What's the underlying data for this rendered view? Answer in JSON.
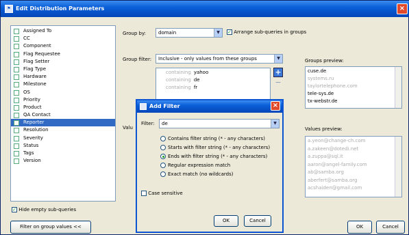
{
  "window": {
    "title": "Edit Distribution Parameters",
    "close": "×"
  },
  "fields": [
    {
      "label": "Assigned To"
    },
    {
      "label": "CC"
    },
    {
      "label": "Component"
    },
    {
      "label": "Flag Requestee"
    },
    {
      "label": "Flag Setter"
    },
    {
      "label": "Flag Type"
    },
    {
      "label": "Hardware"
    },
    {
      "label": "Milestone"
    },
    {
      "label": "OS"
    },
    {
      "label": "Priority"
    },
    {
      "label": "Product"
    },
    {
      "label": "QA Contact"
    },
    {
      "label": "Reporter"
    },
    {
      "label": "Resolution"
    },
    {
      "label": "Severity"
    },
    {
      "label": "Status"
    },
    {
      "label": "Tags"
    },
    {
      "label": "Version"
    }
  ],
  "selected_field": "Reporter",
  "hide_empty": {
    "label": "Hide empty sub-queries",
    "checked": true
  },
  "filter_button": "Filter on group values <<",
  "group_by": {
    "label": "Group by:",
    "value": "domain",
    "arrange_label": "Arrange sub-queries in groups",
    "arrange_checked": true
  },
  "group_filter": {
    "label": "Group filter:",
    "value": "Inclusive - only values from these groups"
  },
  "filters": [
    {
      "op": "containing",
      "val": "yahoo"
    },
    {
      "op": "containing",
      "val": "de"
    },
    {
      "op": "containing",
      "val": "fr"
    }
  ],
  "add_icon": "+",
  "remove_icon": "−",
  "groups_preview": {
    "label": "Groups preview:",
    "items": [
      {
        "text": "cuse.de",
        "gray": false
      },
      {
        "text": "systems.ru",
        "gray": true
      },
      {
        "text": "taylortelephone.com",
        "gray": true
      },
      {
        "text": "tele-sys.de",
        "gray": false
      },
      {
        "text": "tx-webstr.de",
        "gray": false
      }
    ]
  },
  "values_label": "Valu",
  "values_preview": {
    "label": "Values preview:",
    "items": [
      "a.yeon@change-ch.com",
      "a.zakeen@dotedi.net",
      "a.zuppa@sql.it",
      "aaron@angel-family.com",
      "ab@samba.org",
      "aberfert@samba.org",
      "acshaiden@gmail.com"
    ]
  },
  "ok": "OK",
  "cancel": "Cancel",
  "add_filter": {
    "title": "Add Filter",
    "filter_label": "Filter:",
    "filter_value": "de",
    "options": [
      {
        "label": "Contains filter string (* - any characters)",
        "on": false
      },
      {
        "label": "Starts with filter string (* - any characters)",
        "on": false
      },
      {
        "label": "Ends with filter string (* - any characters)",
        "on": true
      },
      {
        "label": "Regular expression match",
        "on": false
      },
      {
        "label": "Exact match (no wildcards)",
        "on": false
      }
    ],
    "case_label": "Case sensitive",
    "case_checked": false,
    "ok": "OK",
    "cancel": "Cancel"
  }
}
